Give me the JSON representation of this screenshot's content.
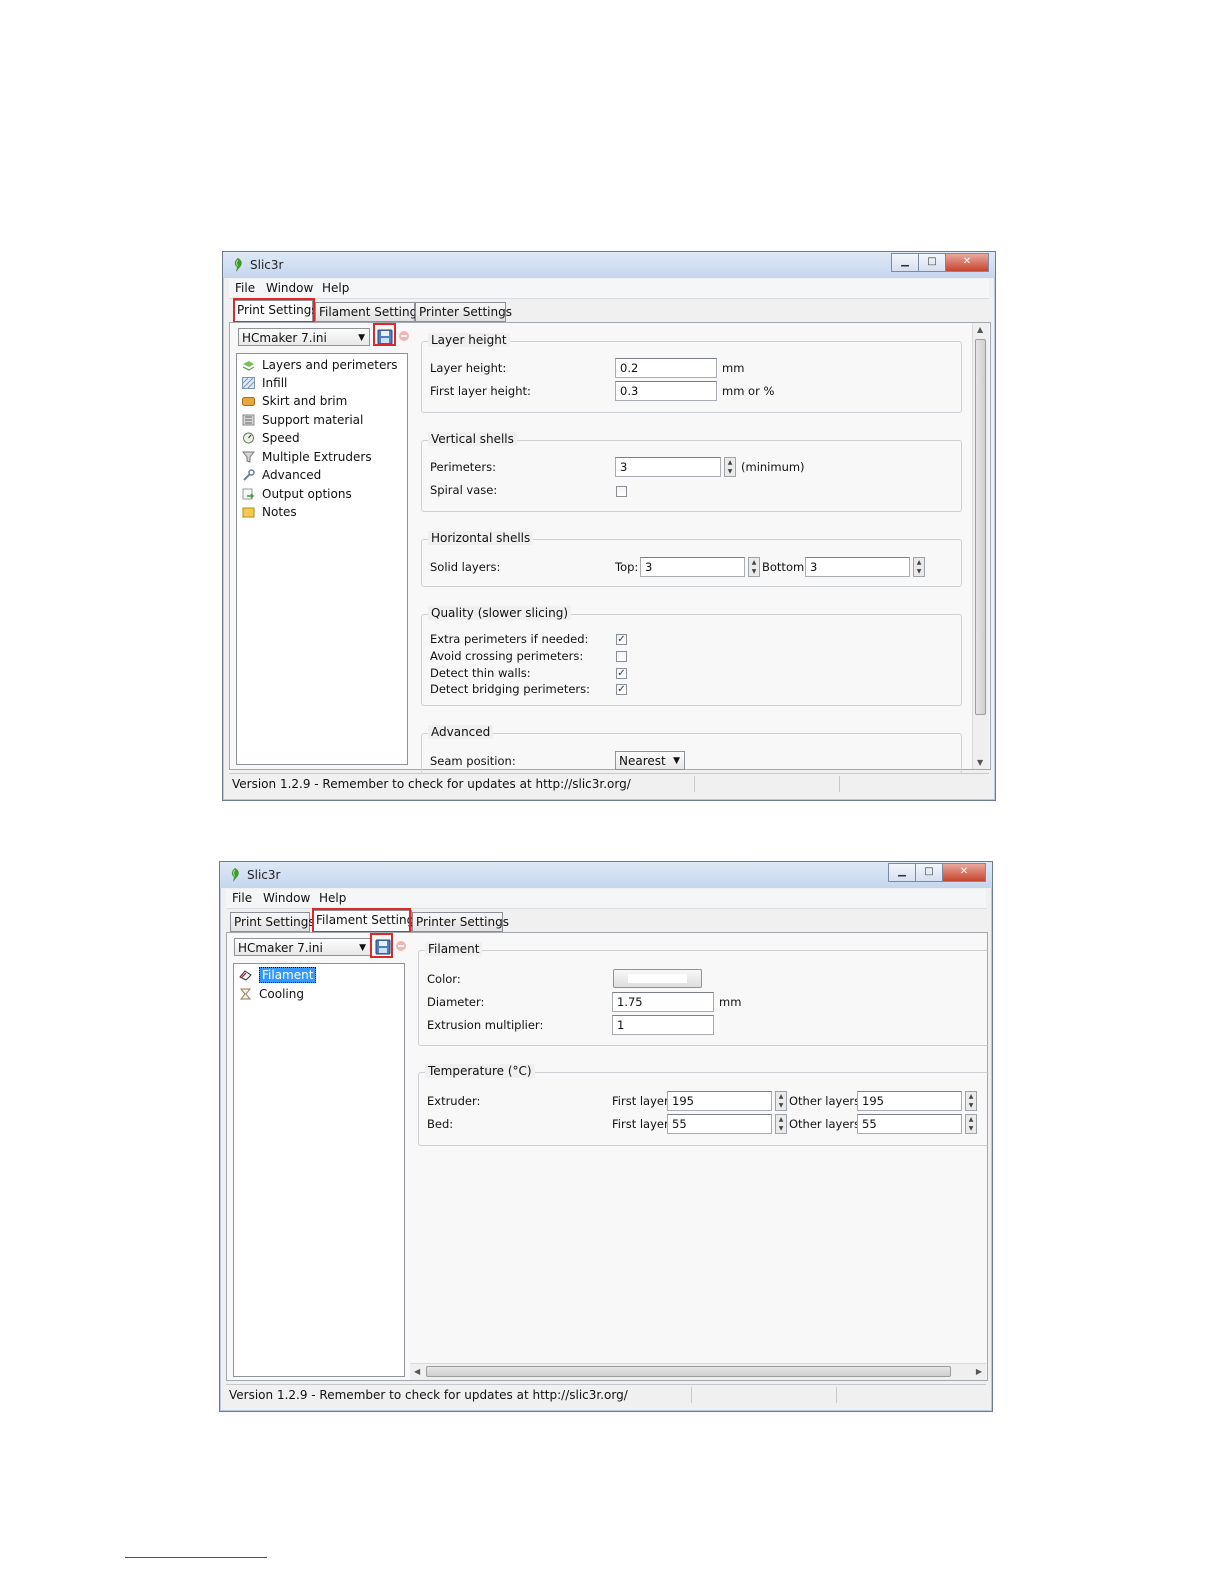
{
  "window1": {
    "title": "Slic3r",
    "menu": [
      "File",
      "Window",
      "Help"
    ],
    "tabs": [
      "Print Settings",
      "Filament Settings",
      "Printer Settings"
    ],
    "active_tab": "Print Settings",
    "preset": "HCmaker 7.ini",
    "tree": [
      "Layers and perimeters",
      "Infill",
      "Skirt and brim",
      "Support material",
      "Speed",
      "Multiple Extruders",
      "Advanced",
      "Output options",
      "Notes"
    ],
    "groups": {
      "layer_height": {
        "title": "Layer height",
        "layer_height_label": "Layer height:",
        "layer_height_value": "0.2",
        "layer_height_unit": "mm",
        "first_layer_label": "First layer height:",
        "first_layer_value": "0.3",
        "first_layer_unit": "mm or %"
      },
      "vertical_shells": {
        "title": "Vertical shells",
        "perimeters_label": "Perimeters:",
        "perimeters_value": "3",
        "perimeters_note": "(minimum)",
        "spiral_label": "Spiral vase:",
        "spiral_checked": false
      },
      "horizontal_shells": {
        "title": "Horizontal shells",
        "solid_label": "Solid layers:",
        "top_label": "Top:",
        "top_value": "3",
        "bottom_label": "Bottom:",
        "bottom_value": "3"
      },
      "quality": {
        "title": "Quality (slower slicing)",
        "options": [
          {
            "label": "Extra perimeters if needed:",
            "checked": true
          },
          {
            "label": "Avoid crossing perimeters:",
            "checked": false
          },
          {
            "label": "Detect thin walls:",
            "checked": true
          },
          {
            "label": "Detect bridging perimeters:",
            "checked": true
          }
        ]
      },
      "advanced": {
        "title": "Advanced",
        "seam_label": "Seam position:",
        "seam_value": "Nearest"
      }
    },
    "status": "Version 1.2.9 - Remember to check for updates at http://slic3r.org/"
  },
  "window2": {
    "title": "Slic3r",
    "menu": [
      "File",
      "Window",
      "Help"
    ],
    "tabs": [
      "Print Settings",
      "Filament Settings",
      "Printer Settings"
    ],
    "active_tab": "Filament Settings",
    "preset": "HCmaker 7.ini",
    "tree": [
      "Filament",
      "Cooling"
    ],
    "selected_tree_item": "Filament",
    "groups": {
      "filament": {
        "title": "Filament",
        "color_label": "Color:",
        "color_value": "#ffffff",
        "diameter_label": "Diameter:",
        "diameter_value": "1.75",
        "diameter_unit": "mm",
        "multiplier_label": "Extrusion multiplier:",
        "multiplier_value": "1"
      },
      "temperature": {
        "title": "Temperature (°C)",
        "extruder_label": "Extruder:",
        "bed_label": "Bed:",
        "first_layer_label": "First layer:",
        "other_layers_label": "Other layers:",
        "extruder_first": "195",
        "extruder_other": "195",
        "bed_first": "55",
        "bed_other": "55"
      }
    },
    "status": "Version 1.2.9 - Remember to check for updates at http://slic3r.org/"
  },
  "colors": {
    "highlight_box": "#e02828",
    "selection": "#3399ff",
    "titlebar": "#c4d6ee",
    "close_button": "#c7442d"
  },
  "icons": {
    "window_controls": [
      "minimize-icon",
      "maximize-icon",
      "close-icon"
    ],
    "save": "save-preset-icon",
    "delete": "delete-preset-icon"
  }
}
